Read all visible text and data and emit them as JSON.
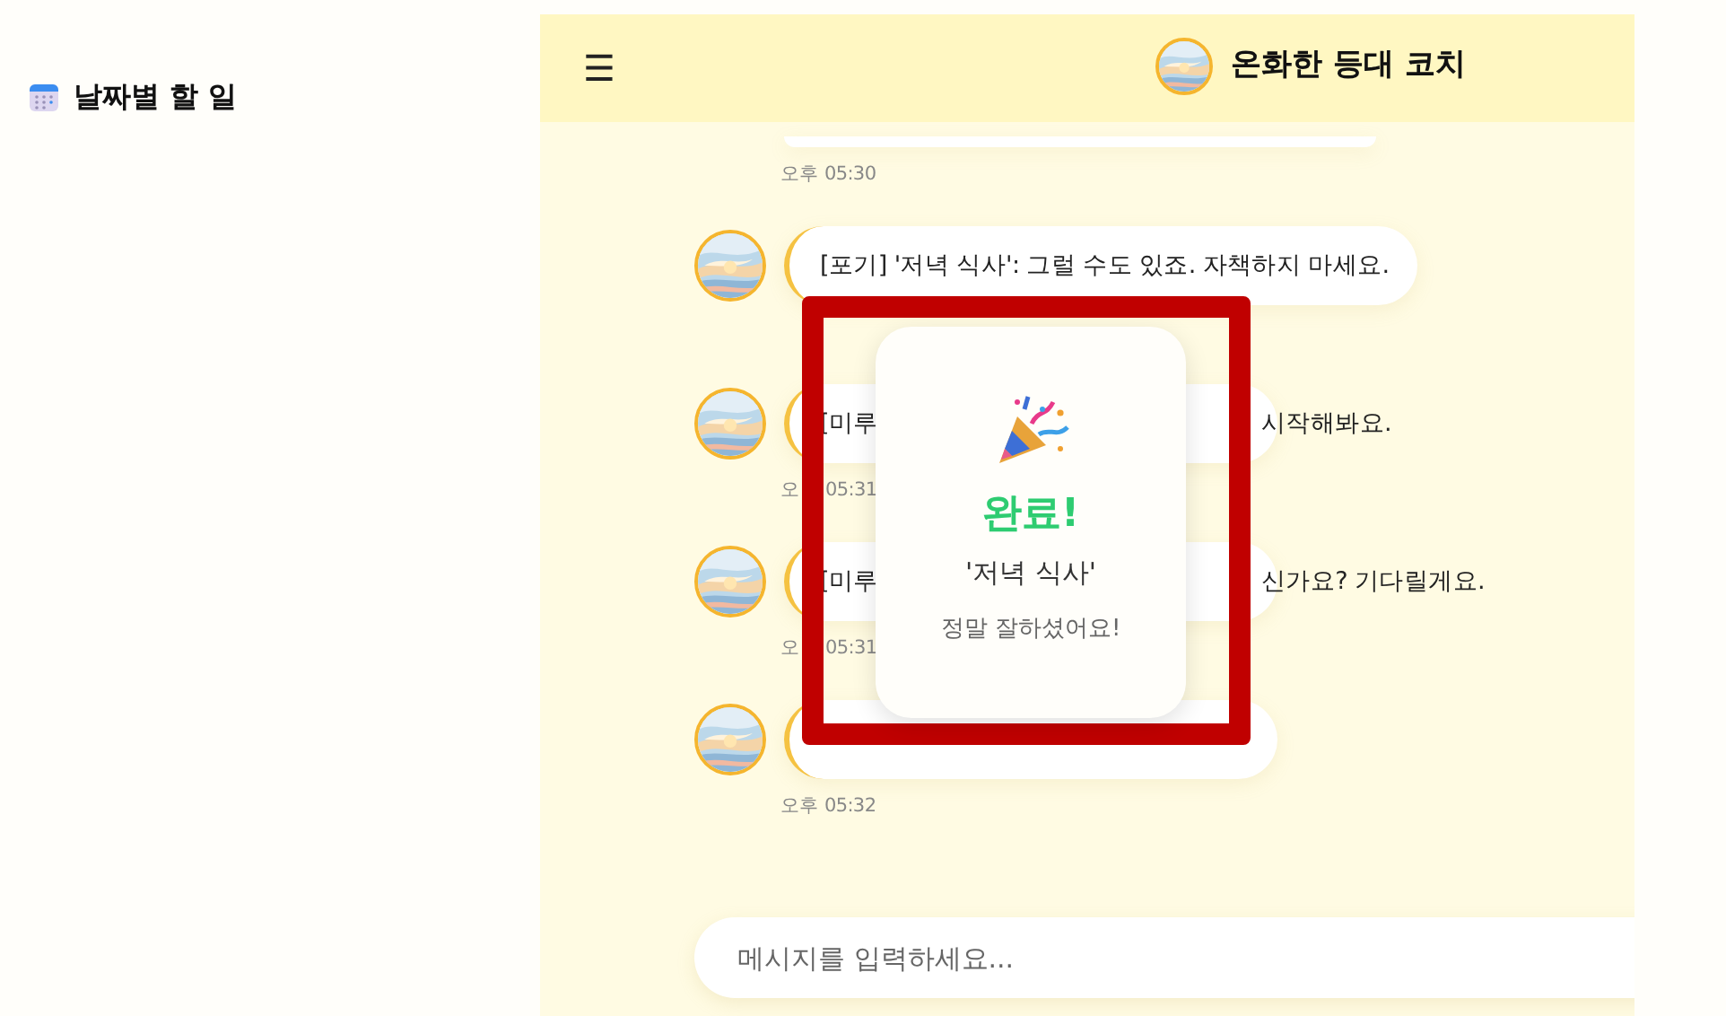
{
  "sidebar": {
    "title": "날짜별 할 일"
  },
  "header": {
    "menu": "☰",
    "title": "온화한 등대 코치"
  },
  "messages": [
    {
      "kind": "cut",
      "time": "오후 05:30"
    },
    {
      "kind": "full",
      "text": "[포기] '저녁 식사': 그럴 수도 있죠. 자책하지 마세요."
    },
    {
      "kind": "covered",
      "parts": [
        "[미루",
        "시작해봐요."
      ],
      "time_parts": [
        "오",
        "05:31"
      ]
    },
    {
      "kind": "covered",
      "parts": [
        "[미루",
        "신가요? 기다릴게요."
      ],
      "time_parts": [
        "오",
        "05:31"
      ]
    },
    {
      "kind": "covered",
      "time": "오후 05:32"
    }
  ],
  "popup": {
    "title": "완료!",
    "task": "'저녁 식사'",
    "message": "정말 잘하셨어요!"
  },
  "composer": {
    "placeholder": "메시지를 입력하세요..."
  }
}
